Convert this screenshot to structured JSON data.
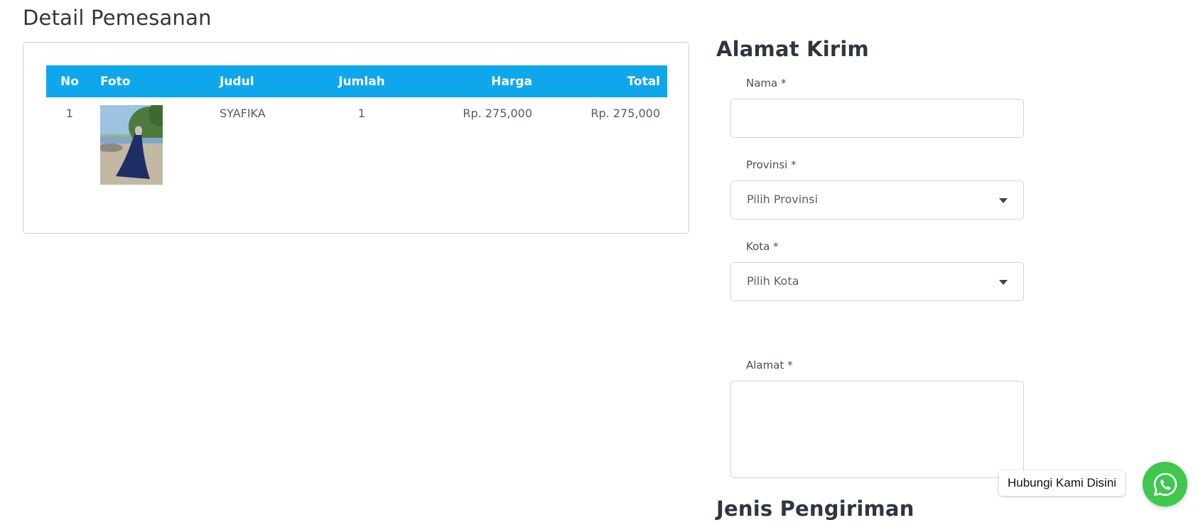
{
  "order": {
    "title": "Detail Pemesanan",
    "columns": {
      "no": "No",
      "foto": "Foto",
      "judul": "Judul",
      "jumlah": "Jumlah",
      "harga": "Harga",
      "total": "Total"
    },
    "rows": [
      {
        "no": "1",
        "photo_icon": "product-photo-dress",
        "judul": "SYAFIKA",
        "jumlah": "1",
        "harga": "Rp. 275,000",
        "total": "Rp. 275,000"
      }
    ]
  },
  "address": {
    "title": "Alamat Kirim",
    "nama_label": "Nama *",
    "nama_value": "",
    "provinsi_label": "Provinsi *",
    "provinsi_selected": "Pilih Provinsi",
    "kota_label": "Kota *",
    "kota_selected": "Pilih Kota",
    "alamat_label": "Alamat *",
    "alamat_value": ""
  },
  "shipping": {
    "title": "Jenis Pengiriman"
  },
  "whatsapp": {
    "label": "Hubungi Kami Disini",
    "icon": "whatsapp-icon",
    "color": "#3fc74e"
  },
  "colors": {
    "table_header": "#0ea7ec"
  }
}
